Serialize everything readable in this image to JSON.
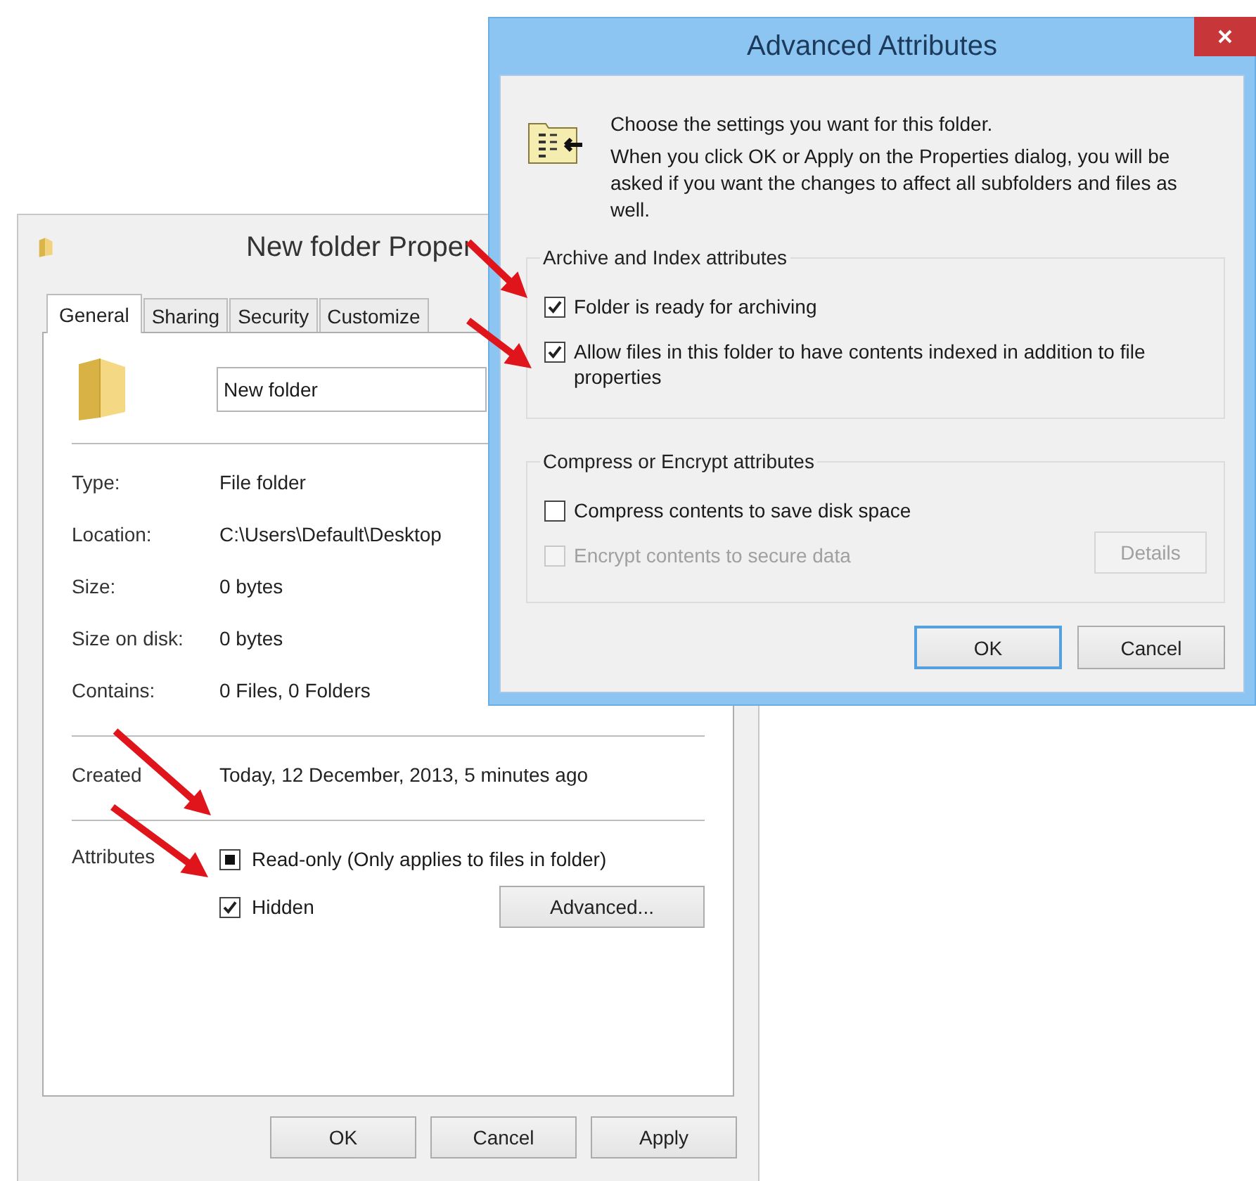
{
  "properties_window": {
    "title": "New folder Proper",
    "tabs": [
      {
        "label": "General",
        "selected": true
      },
      {
        "label": "Sharing",
        "selected": false
      },
      {
        "label": "Security",
        "selected": false
      },
      {
        "label": "Customize",
        "selected": false
      }
    ],
    "name_field": {
      "value": "New folder"
    },
    "info_rows": [
      {
        "label": "Type:",
        "value": "File folder"
      },
      {
        "label": "Location:",
        "value": "C:\\Users\\Default\\Desktop"
      },
      {
        "label": "Size:",
        "value": "0 bytes"
      },
      {
        "label": "Size on disk:",
        "value": "0 bytes"
      },
      {
        "label": "Contains:",
        "value": "0 Files, 0 Folders"
      }
    ],
    "created": {
      "label": "Created",
      "value": "Today, 12 December, 2013, 5 minutes ago"
    },
    "attributes_label": "Attributes",
    "attributes": [
      {
        "label": "Read-only (Only applies to files in folder)",
        "checked": false,
        "indeterminate": true
      },
      {
        "label": "Hidden",
        "checked": true,
        "indeterminate": false
      }
    ],
    "advanced_button": "Advanced...",
    "buttons": [
      "OK",
      "Cancel",
      "Apply"
    ]
  },
  "advanced_window": {
    "title": "Advanced Attributes",
    "heading": "Choose the settings you want for this folder.",
    "description": "When you click OK or Apply on the Properties dialog, you will be asked if you want the changes to affect all subfolders and files as well.",
    "groups": [
      {
        "title": "Archive and Index attributes",
        "options": [
          {
            "label": "Folder is ready for archiving",
            "checked": true,
            "disabled": false
          },
          {
            "label": "Allow files in this folder to have contents indexed in addition to file properties",
            "checked": true,
            "disabled": false
          }
        ]
      },
      {
        "title": "Compress or Encrypt attributes",
        "options": [
          {
            "label": "Compress contents to save disk space",
            "checked": false,
            "disabled": false
          },
          {
            "label": "Encrypt contents to secure data",
            "checked": false,
            "disabled": true,
            "button": {
              "label": "Details",
              "disabled": true
            }
          }
        ]
      }
    ],
    "buttons": [
      {
        "label": "OK",
        "default": true
      },
      {
        "label": "Cancel",
        "default": false
      }
    ]
  }
}
